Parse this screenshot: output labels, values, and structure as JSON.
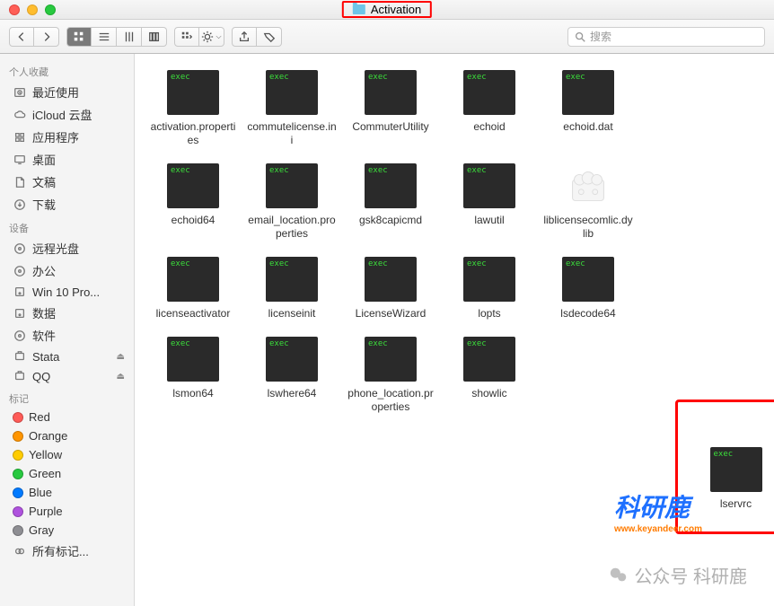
{
  "window": {
    "title": "Activation"
  },
  "toolbar": {
    "search_placeholder": "搜索"
  },
  "sidebar": {
    "sections": [
      {
        "header": "个人收藏",
        "items": [
          {
            "label": "最近使用",
            "icon": "clock"
          },
          {
            "label": "iCloud 云盘",
            "icon": "cloud"
          },
          {
            "label": "应用程序",
            "icon": "app"
          },
          {
            "label": "桌面",
            "icon": "desktop"
          },
          {
            "label": "文稿",
            "icon": "doc"
          },
          {
            "label": "下载",
            "icon": "download"
          }
        ]
      },
      {
        "header": "设备",
        "items": [
          {
            "label": "远程光盘",
            "icon": "disc"
          },
          {
            "label": "办公",
            "icon": "disc"
          },
          {
            "label": "Win 10 Pro...",
            "icon": "disk"
          },
          {
            "label": "数据",
            "icon": "disk"
          },
          {
            "label": "软件",
            "icon": "disc"
          },
          {
            "label": "Stata",
            "icon": "ext",
            "eject": true
          },
          {
            "label": "QQ",
            "icon": "ext",
            "eject": true
          }
        ]
      },
      {
        "header": "标记",
        "items": [
          {
            "label": "Red",
            "color": "#ff5b57"
          },
          {
            "label": "Orange",
            "color": "#ff9500"
          },
          {
            "label": "Yellow",
            "color": "#ffcc00"
          },
          {
            "label": "Green",
            "color": "#28c940"
          },
          {
            "label": "Blue",
            "color": "#007aff"
          },
          {
            "label": "Purple",
            "color": "#af52de"
          },
          {
            "label": "Gray",
            "color": "#8e8e93"
          },
          {
            "label": "所有标记...",
            "icon": "alltags"
          }
        ]
      }
    ]
  },
  "files": [
    {
      "name": "activation.properties",
      "type": "exec"
    },
    {
      "name": "commutelicense.ini",
      "type": "exec"
    },
    {
      "name": "CommuterUtility",
      "type": "exec"
    },
    {
      "name": "echoid",
      "type": "exec"
    },
    {
      "name": "echoid.dat",
      "type": "exec"
    },
    {
      "name": "echoid64",
      "type": "exec"
    },
    {
      "name": "email_location.properties",
      "type": "exec"
    },
    {
      "name": "gsk8capicmd",
      "type": "exec"
    },
    {
      "name": "lawutil",
      "type": "exec"
    },
    {
      "name": "liblicensecomlic.dylib",
      "type": "dylib"
    },
    {
      "name": "licenseactivator",
      "type": "exec"
    },
    {
      "name": "licenseinit",
      "type": "exec"
    },
    {
      "name": "LicenseWizard",
      "type": "exec"
    },
    {
      "name": "lopts",
      "type": "exec"
    },
    {
      "name": "lsdecode64",
      "type": "exec"
    },
    {
      "name": "lsmon64",
      "type": "exec"
    },
    {
      "name": "lswhere64",
      "type": "exec"
    },
    {
      "name": "phone_location.properties",
      "type": "exec"
    },
    {
      "name": "showlic",
      "type": "exec"
    }
  ],
  "highlighted_file": {
    "name": "lservrc",
    "type": "exec"
  },
  "watermark": {
    "main": "科研鹿",
    "url": "www.keyandeer.com",
    "footer": "公众号  科研鹿"
  }
}
